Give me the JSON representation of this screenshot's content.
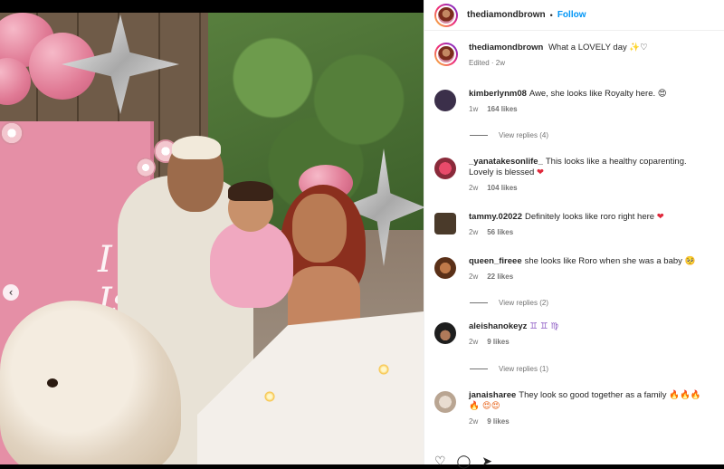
{
  "post": {
    "author": "thediamondbrown",
    "follow_label": "Follow",
    "separator": "•",
    "caption_text": "What a LOVELY day",
    "caption_emoji": "✨♡",
    "caption_meta": "Edited · 2w"
  },
  "photo": {
    "sign_text": "I  Is",
    "prev_icon": "‹"
  },
  "comments": [
    {
      "user": "kimberlynm08",
      "text": "Awe, she looks like Royalty here.",
      "emoji": "😍",
      "time": "1w",
      "likes": "164 likes",
      "avatar_color": "#3b2f4a",
      "replies": "View replies (4)"
    },
    {
      "user": "_yanatakesonlife_",
      "text": "This looks like a healthy coparenting. Lovely is blessed",
      "emoji": "❤",
      "time": "2w",
      "likes": "104 likes",
      "avatar_color": "#8a2a3a",
      "replies": ""
    },
    {
      "user": "tammy.02022",
      "text": "Definitely looks like roro right here",
      "emoji": "❤",
      "time": "2w",
      "likes": "56 likes",
      "avatar_color": "#4a3a2a",
      "replies": ""
    },
    {
      "user": "queen_fireee",
      "text": "she looks like Roro when she was a baby",
      "emoji": "🥺",
      "time": "2w",
      "likes": "22 likes",
      "avatar_color": "#7a4a2a",
      "replies": "View replies (2)"
    },
    {
      "user": "aleishanokeyz",
      "text": "",
      "emoji": "♊ ♊ ♍",
      "time": "2w",
      "likes": "9 likes",
      "avatar_color": "#2a2a2a",
      "replies": "View replies (1)"
    },
    {
      "user": "janaisharee",
      "text": "They look so good together as a family",
      "emoji": "🔥🔥🔥🔥 😍😍",
      "time": "2w",
      "likes": "9 likes",
      "avatar_color": "#c9b7a8",
      "replies": ""
    }
  ],
  "icons": {
    "heart_outline": "♡",
    "comment": "◯",
    "share": "➤"
  }
}
